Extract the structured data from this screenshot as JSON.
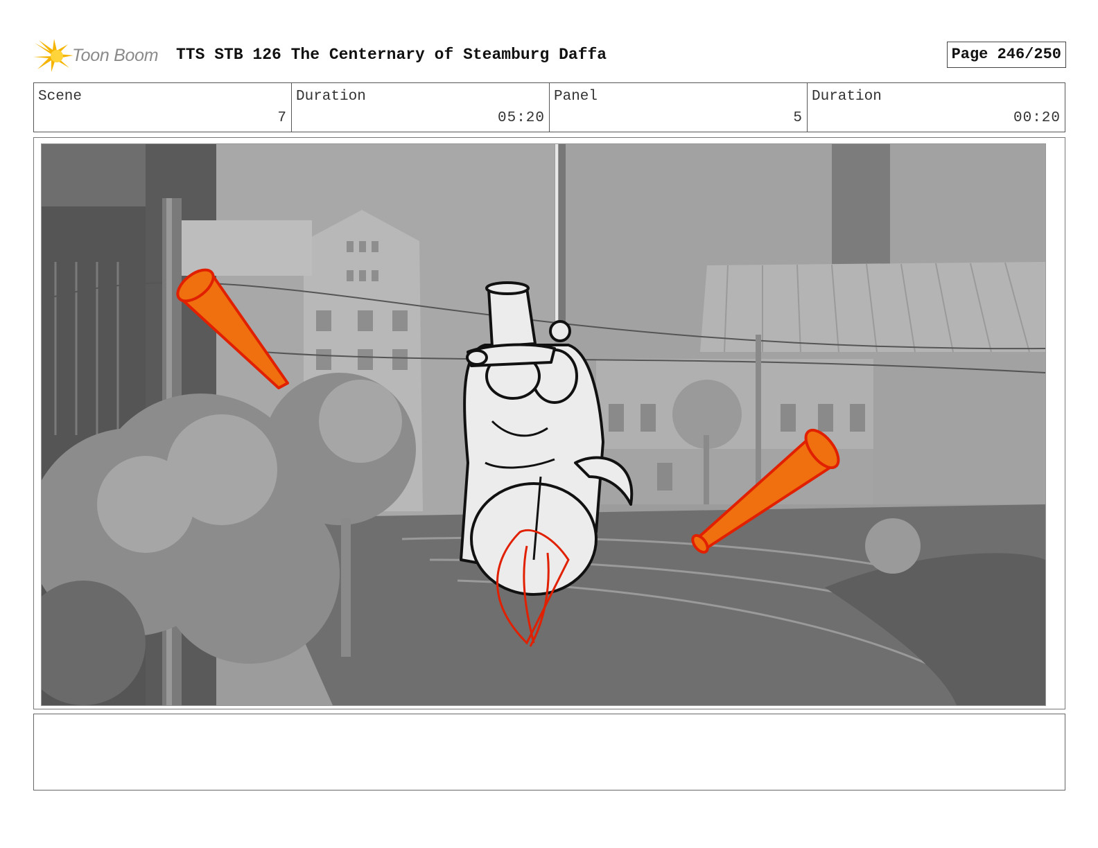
{
  "brand": {
    "name": "Toon Boom",
    "accent": "#f5b400"
  },
  "document": {
    "title": "TTS STB 126 The Centernary of Steamburg Daffa"
  },
  "page": {
    "label": "Page 246/250"
  },
  "info": {
    "scene_label": "Scene",
    "scene_value": "7",
    "scene_duration_label": "Duration",
    "scene_duration_value": "05:20",
    "panel_label": "Panel",
    "panel_value": "5",
    "panel_duration_label": "Duration",
    "panel_duration_value": "00:20"
  },
  "panel": {
    "image": "storyboard-sketch",
    "description_colors": {
      "cone": "#f07010",
      "sketch_red": "#e02000",
      "background": "#8a8a8a"
    }
  },
  "notes": {
    "text": ""
  }
}
